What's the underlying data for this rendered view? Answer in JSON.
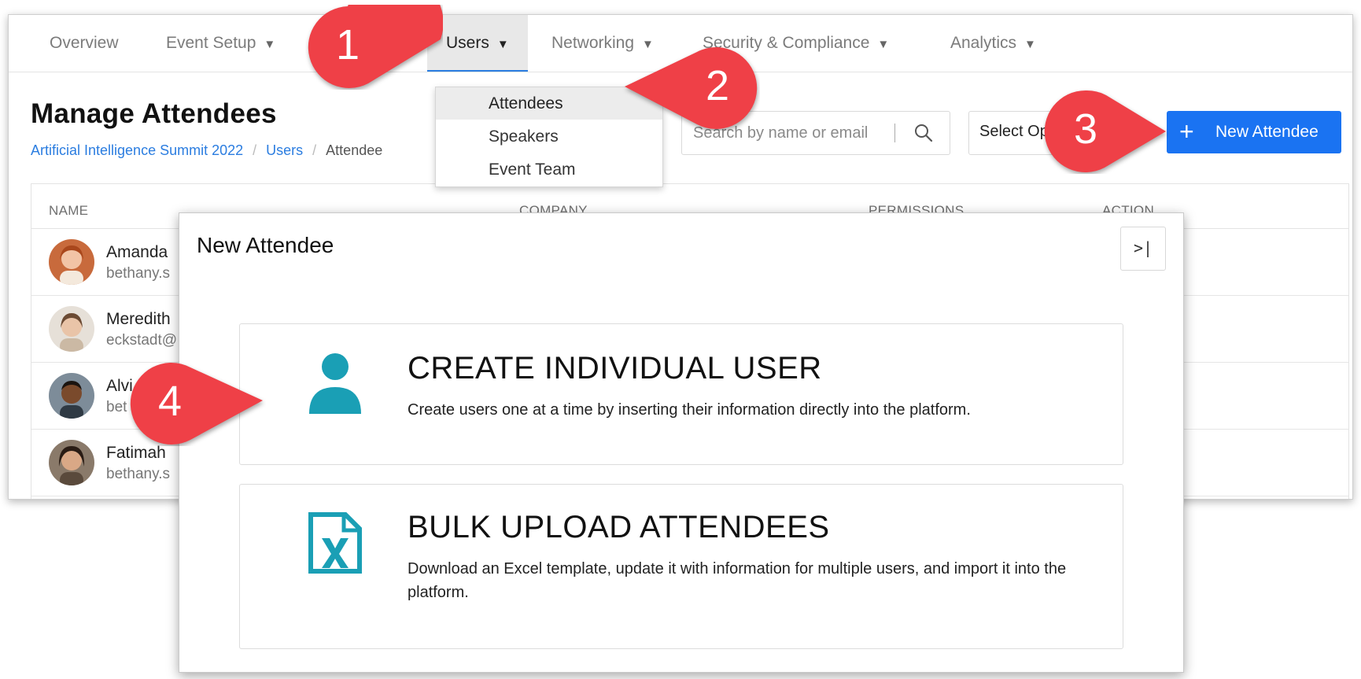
{
  "nav": {
    "items": [
      {
        "label": "Overview",
        "caret": ""
      },
      {
        "label": "Event Setup",
        "caret": "▼"
      },
      {
        "label": "Users",
        "caret": "▼"
      },
      {
        "label": "Networking",
        "caret": "▼"
      },
      {
        "label": "Security & Compliance",
        "caret": "▼"
      },
      {
        "label": "Analytics",
        "caret": "▼"
      }
    ],
    "active": "Users"
  },
  "dropdown": {
    "items": [
      "Attendees",
      "Speakers",
      "Event Team"
    ],
    "highlighted": "Attendees"
  },
  "page": {
    "title": "Manage Attendees",
    "breadcrumb": [
      "Artificial Intelligence Summit 2022",
      "Users",
      "Attendee"
    ],
    "breadcrumb_sep": "/",
    "search_placeholder": "Search by name or email",
    "select_value": "Select Op",
    "new_button": "New Attendee",
    "new_button_icon": "plus-icon"
  },
  "table": {
    "headers": [
      "NAME",
      "COMPANY",
      "PERMISSIONS",
      "ACTION"
    ],
    "rows": [
      {
        "name": "Amanda",
        "email": "bethany.s"
      },
      {
        "name": "Meredith",
        "email": "eckstadt@"
      },
      {
        "name": "Alvi",
        "email": "bet"
      },
      {
        "name": "Fatimah",
        "email": "bethany.s"
      }
    ]
  },
  "panel": {
    "title": "New Attendee",
    "collapse_label": ">|",
    "options": [
      {
        "title": "CREATE INDIVIDUAL USER",
        "description": "Create users one at a time by inserting their information directly into the platform.",
        "icon": "person-icon"
      },
      {
        "title": "BULK UPLOAD ATTENDEES",
        "description": "Download an Excel template, update it with information for multiple users, and import it into the platform.",
        "icon": "excel-file-icon"
      }
    ]
  },
  "callouts": [
    "1",
    "2",
    "3",
    "4"
  ],
  "colors": {
    "accent": "#1a73f2",
    "callout": "#ef4047",
    "icon_teal": "#1a9fb5",
    "link": "#2b7de0"
  }
}
